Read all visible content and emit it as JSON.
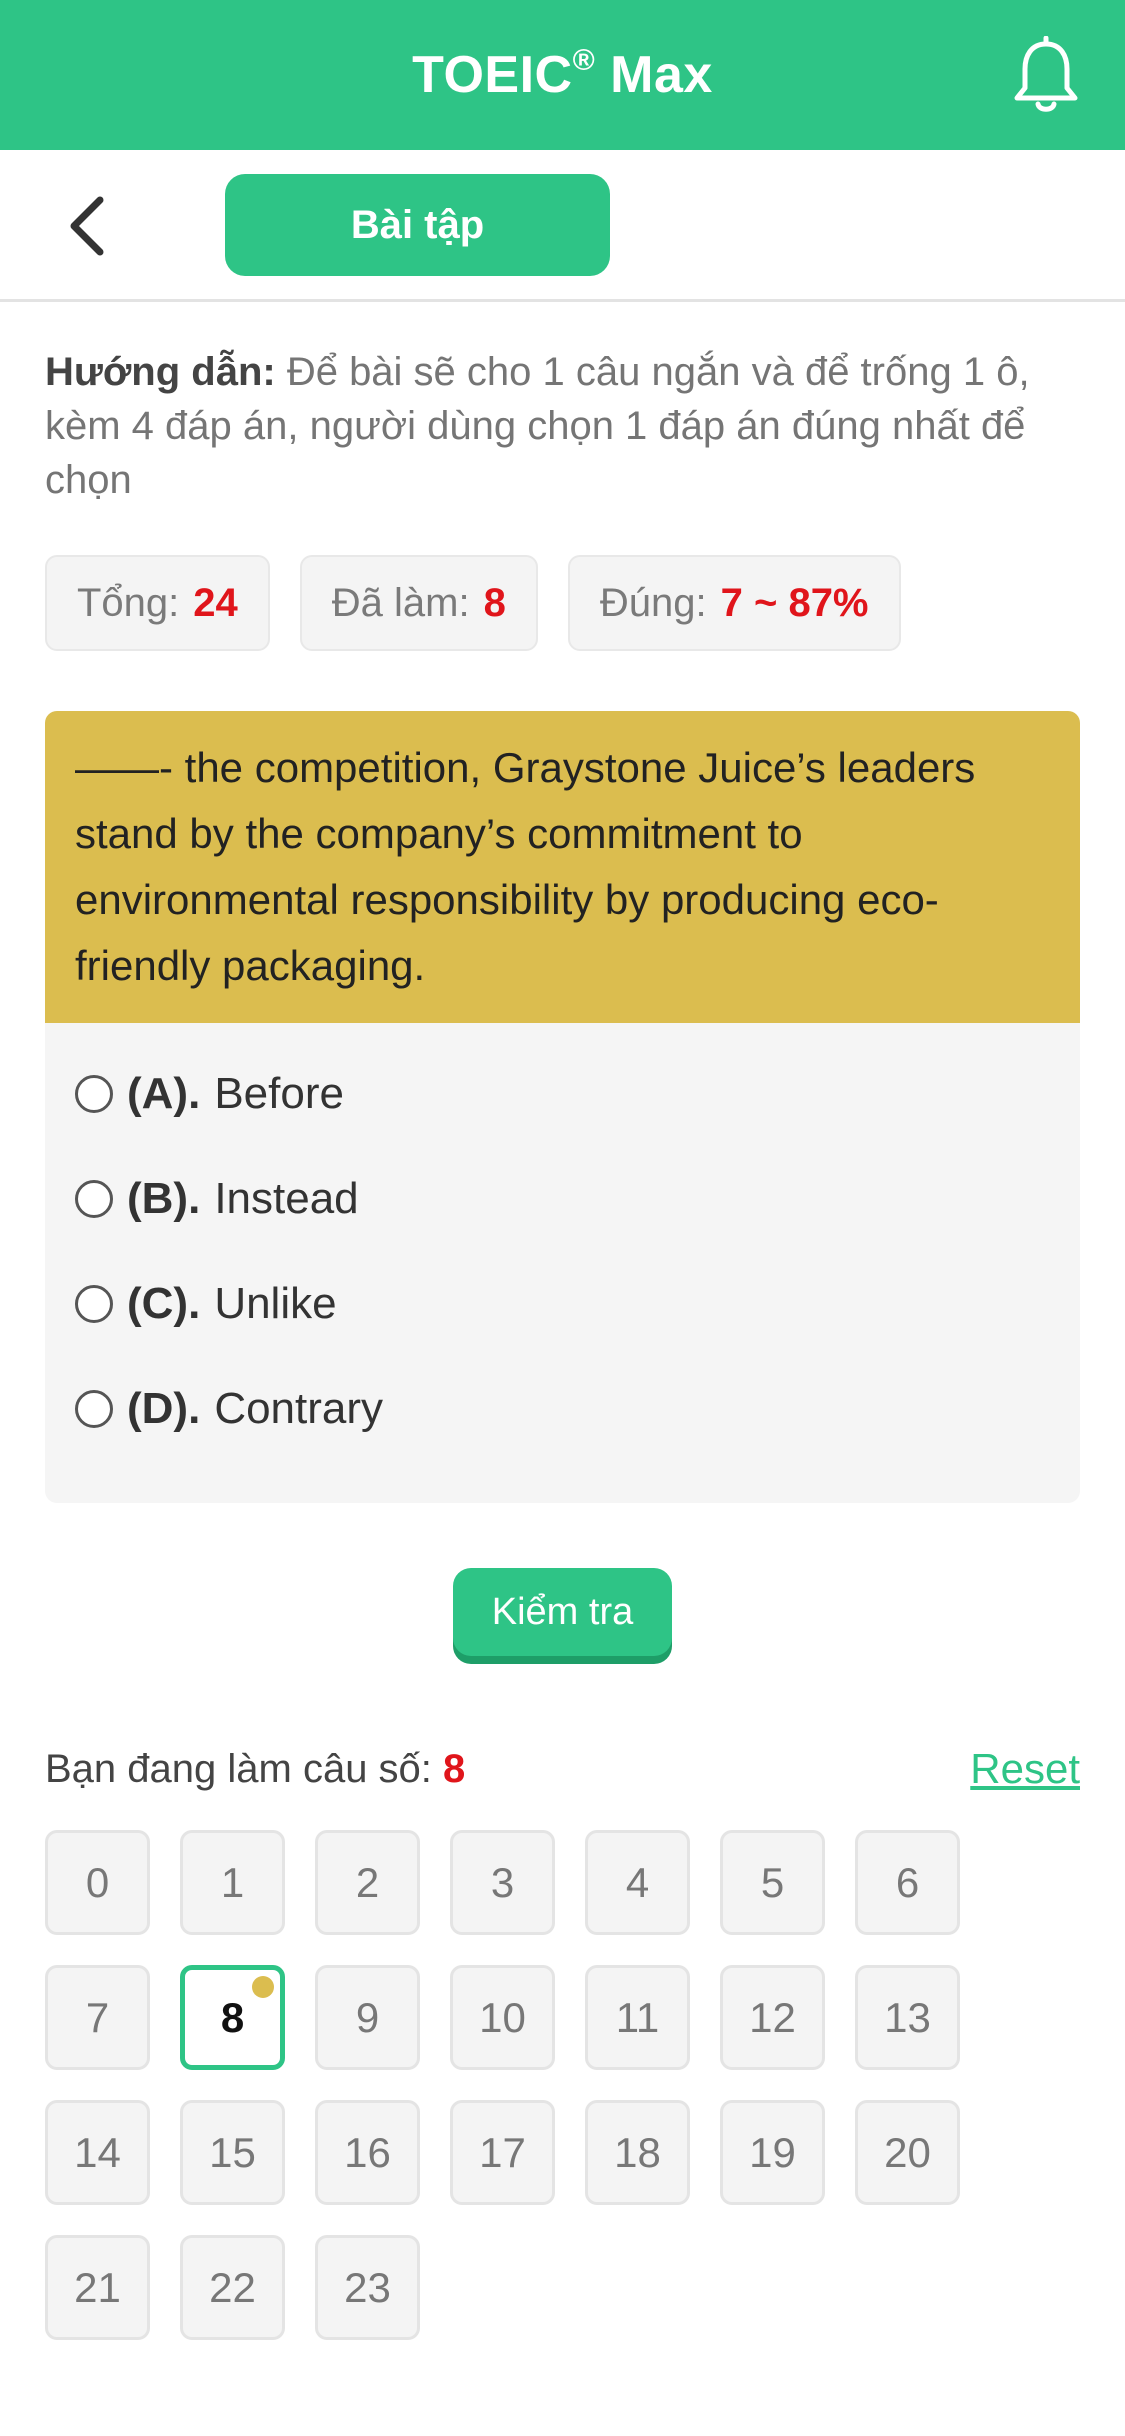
{
  "header": {
    "title": "TOEIC",
    "title_mark": "®",
    "title_suffix": " Max",
    "bell_icon": "bell-icon"
  },
  "subbar": {
    "back_icon": "chevron-left-icon",
    "tab_label": "Bài tập"
  },
  "instructions": {
    "label": "Hướng dẫn:",
    "text": " Để bài sẽ cho 1 câu ngắn và để trống 1 ô, kèm 4 đáp án, người dùng chọn 1 đáp án đúng nhất để chọn"
  },
  "stats": {
    "total_label": "Tổng:",
    "total_value": "24",
    "done_label": "Đã làm:",
    "done_value": "8",
    "correct_label": "Đúng:",
    "correct_value": "7 ~ 87%"
  },
  "question": {
    "text": "——- the competition, Graystone Juice’s leaders stand by the company’s commitment to environmental responsibility by producing eco-friendly packaging.",
    "options": [
      {
        "letter": "(A).",
        "text": "Before"
      },
      {
        "letter": "(B).",
        "text": "Instead"
      },
      {
        "letter": "(C).",
        "text": "Unlike"
      },
      {
        "letter": "(D).",
        "text": "Contrary"
      }
    ]
  },
  "check_button": "Kiểm tra",
  "progress": {
    "label": "Bạn đang làm câu số:",
    "current": "8",
    "reset": "Reset"
  },
  "grid": [
    "0",
    "1",
    "2",
    "3",
    "4",
    "5",
    "6",
    "7",
    "8",
    "9",
    "10",
    "11",
    "12",
    "13",
    "14",
    "15",
    "16",
    "17",
    "18",
    "19",
    "20",
    "21",
    "22",
    "23"
  ],
  "colors": {
    "brand": "#2ec486",
    "question_bg": "#dbbd4f",
    "highlight_red": "#e0151b"
  }
}
